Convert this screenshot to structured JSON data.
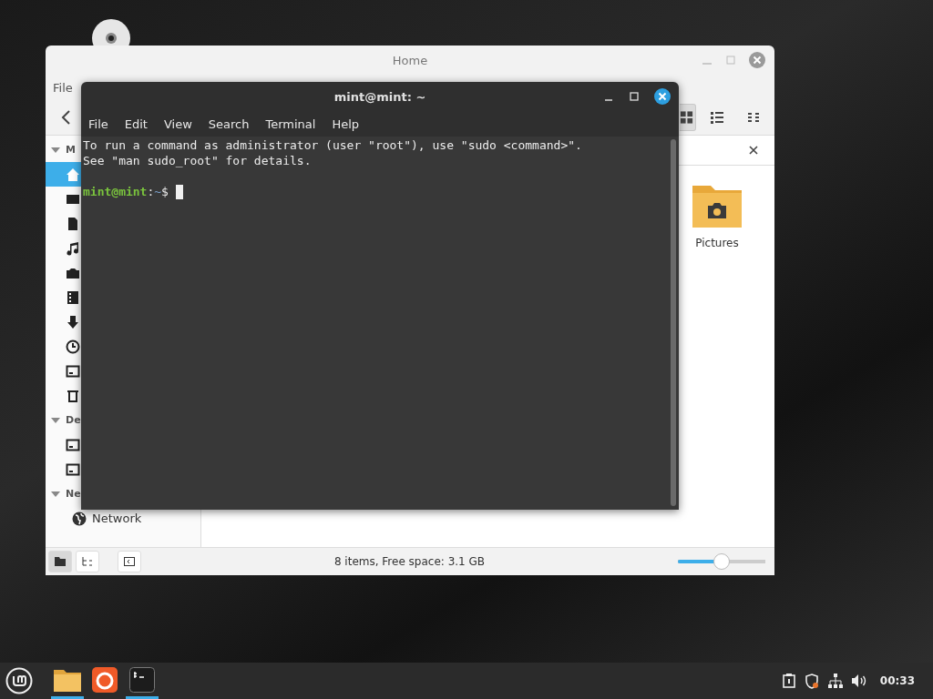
{
  "file_manager": {
    "title": "Home",
    "menu": [
      "File"
    ],
    "sidebar": {
      "sections": [
        {
          "heading": "M",
          "expanded": true,
          "items": [
            {
              "kind": "home",
              "selected": true
            },
            {
              "kind": "desktop",
              "selected": false
            },
            {
              "kind": "documents",
              "selected": false
            },
            {
              "kind": "music",
              "selected": false
            },
            {
              "kind": "pictures",
              "selected": false
            },
            {
              "kind": "videos",
              "selected": false
            },
            {
              "kind": "downloads",
              "selected": false
            },
            {
              "kind": "recent",
              "selected": false
            },
            {
              "kind": "drive",
              "selected": false
            },
            {
              "kind": "trash",
              "selected": false
            }
          ]
        },
        {
          "heading": "De",
          "expanded": true,
          "items": [
            {
              "kind": "drive",
              "selected": false
            },
            {
              "kind": "drive",
              "selected": false
            }
          ]
        },
        {
          "heading": "Ne",
          "expanded": true,
          "items": [
            {
              "kind": "network",
              "label": "Network",
              "selected": false
            }
          ]
        }
      ]
    },
    "view_buttons": [
      {
        "kind": "grid",
        "selected": true
      },
      {
        "kind": "list",
        "selected": false
      },
      {
        "kind": "compact",
        "selected": false
      }
    ],
    "files": [
      {
        "name": "Pictures",
        "kind": "pictures"
      }
    ],
    "status": "8 items, Free space: 3.1 GB",
    "zoom": {
      "level": 0.5
    }
  },
  "terminal": {
    "title": "mint@mint: ~",
    "menu": [
      "File",
      "Edit",
      "View",
      "Search",
      "Terminal",
      "Help"
    ],
    "lines": [
      "To run a command as administrator (user \"root\"), use \"sudo <command>\".",
      "See \"man sudo_root\" for details."
    ],
    "prompt": {
      "user": "mint@mint",
      "separator": ":",
      "path": "~",
      "symbol": "$"
    }
  },
  "taskbar": {
    "apps": [
      {
        "kind": "files",
        "running": true
      },
      {
        "kind": "firefox",
        "running": false
      },
      {
        "kind": "terminal",
        "running": true
      }
    ],
    "clock": "00:33"
  }
}
